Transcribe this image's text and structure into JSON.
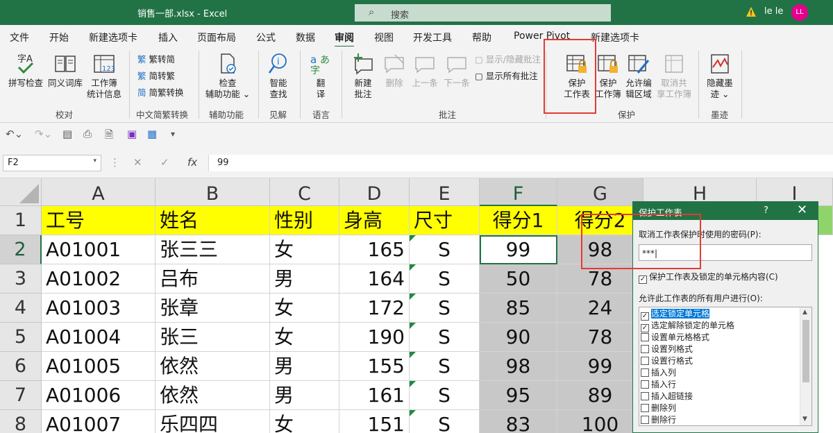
{
  "window": {
    "doc_title": "销售一部.xlsx  -  Excel",
    "search_placeholder": "搜索",
    "user_name": "le le",
    "user_initials": "LL"
  },
  "menu": [
    "文件",
    "开始",
    "新建选项卡",
    "插入",
    "页面布局",
    "公式",
    "数据",
    "审阅",
    "视图",
    "开发工具",
    "帮助",
    "Power Pivot",
    "新建选项卡"
  ],
  "ribbon": {
    "groups": {
      "proofing": "校对",
      "chinese": "中文简繁转换",
      "accessibility": "辅助功能",
      "insights": "见解",
      "language": "语言",
      "comments": "批注",
      "protect": "保护",
      "ink": "墨迹"
    },
    "spell": "拼写检查",
    "thesaurus": "同义词库",
    "stats1": "工作簿",
    "stats2": "统计信息",
    "to_trad": "繁转简",
    "to_simp": "简转繁",
    "convert": "简繁转换",
    "check1": "检查",
    "check2": "辅助功能",
    "smart1": "智能",
    "smart2": "查找",
    "translate1": "翻",
    "translate2": "译",
    "newc1": "新建",
    "newc2": "批注",
    "delete": "删除",
    "prev": "上一条",
    "next": "下一条",
    "show_hide": "显示/隐藏批注",
    "show_all": "显示所有批注",
    "protect_sheet1": "保护",
    "protect_sheet2": "工作表",
    "protect_book1": "保护",
    "protect_book2": "工作簿",
    "allow1": "允许编",
    "allow2": "辑区域",
    "unshare1": "取消共",
    "unshare2": "享工作簿",
    "hide_ink1": "隐藏墨",
    "hide_ink2": "迹"
  },
  "formula_bar": {
    "name_box": "F2",
    "fx": "fx",
    "value": "99"
  },
  "sheet": {
    "columns": [
      "A",
      "B",
      "C",
      "D",
      "E",
      "F",
      "G",
      "H",
      "I"
    ],
    "rows": [
      "1",
      "2",
      "3",
      "4",
      "5",
      "6",
      "7",
      "8"
    ],
    "header_row": [
      "工号",
      "姓名",
      "性别",
      "身高",
      "尺寸",
      "得分1",
      "得分2"
    ],
    "data": [
      [
        "A01001",
        "张三三",
        "女",
        "165",
        "S",
        "99",
        "98"
      ],
      [
        "A01002",
        "吕布",
        "男",
        "164",
        "S",
        "50",
        "78"
      ],
      [
        "A01003",
        "张章",
        "女",
        "172",
        "S",
        "85",
        "24"
      ],
      [
        "A01004",
        "张三",
        "女",
        "190",
        "S",
        "90",
        "78"
      ],
      [
        "A01005",
        "依然",
        "男",
        "155",
        "S",
        "98",
        "99"
      ],
      [
        "A01006",
        "依然",
        "男",
        "161",
        "S",
        "95",
        "89"
      ],
      [
        "A01007",
        "乐四四",
        "女",
        "151",
        "S",
        "83",
        "100"
      ]
    ]
  },
  "dialog": {
    "title": "保护工作表",
    "help": "?",
    "close": "✕",
    "pwd_label": "取消工作表保护时使用的密码(P):",
    "pwd_value": "***",
    "protect_contents": "保护工作表及锁定的单元格内容(C)",
    "allow_label": "允许此工作表的所有用户进行(O):",
    "permissions": [
      {
        "label": "选定锁定单元格",
        "checked": true
      },
      {
        "label": "选定解除锁定的单元格",
        "checked": true
      },
      {
        "label": "设置单元格格式",
        "checked": false
      },
      {
        "label": "设置列格式",
        "checked": false
      },
      {
        "label": "设置行格式",
        "checked": false
      },
      {
        "label": "插入列",
        "checked": false
      },
      {
        "label": "插入行",
        "checked": false
      },
      {
        "label": "插入超链接",
        "checked": false
      },
      {
        "label": "删除列",
        "checked": false
      },
      {
        "label": "删除行",
        "checked": false
      }
    ]
  },
  "colors": {
    "excel_green": "#217346",
    "header_fill": "#ffff00",
    "gray_fill": "#c8c8c8",
    "highlight_red": "#e53935"
  }
}
